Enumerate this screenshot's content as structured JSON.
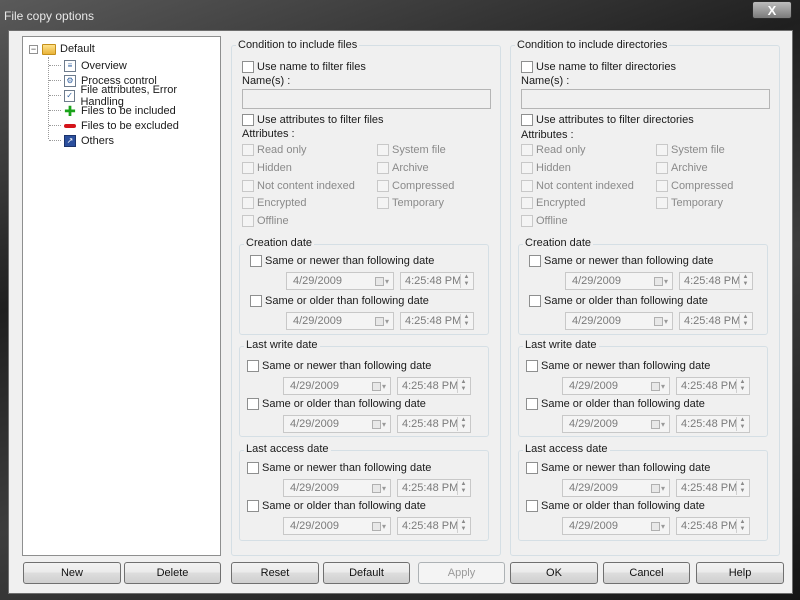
{
  "window": {
    "title": "File copy options",
    "close_glyph": "X"
  },
  "tree": {
    "root": {
      "label": "Default",
      "expander": "−",
      "icon": "folder-icon"
    },
    "items": [
      {
        "label": "Overview",
        "icon": "document-icon"
      },
      {
        "label": "Process control",
        "icon": "process-icon"
      },
      {
        "label": "File attributes, Error Handling",
        "icon": "check-icon"
      },
      {
        "label": "Files to be included",
        "icon": "plus-icon"
      },
      {
        "label": "Files to be excluded",
        "icon": "minus-icon"
      },
      {
        "label": "Others",
        "icon": "others-icon"
      }
    ]
  },
  "files_panel": {
    "title": "Condition to include files",
    "use_name": "Use name to filter files",
    "names_label": "Name(s) :",
    "names_value": "",
    "use_attributes": "Use attributes to filter files",
    "attributes_label": "Attributes :",
    "attrs_left": [
      "Read only",
      "Hidden",
      "Not content indexed",
      "Encrypted",
      "Offline"
    ],
    "attrs_right": [
      "System file",
      "Archive",
      "Compressed",
      "Temporary"
    ]
  },
  "dirs_panel": {
    "title": "Condition to include directories",
    "use_name": "Use name to filter directories",
    "names_label": "Name(s) :",
    "names_value": "",
    "use_attributes": "Use attributes to filter directories",
    "attributes_label": "Attributes :",
    "attrs_left": [
      "Read only",
      "Hidden",
      "Not content indexed",
      "Encrypted",
      "Offline"
    ],
    "attrs_right": [
      "System file",
      "Archive",
      "Compressed",
      "Temporary"
    ]
  },
  "date_groups": {
    "creation": "Creation date",
    "last_write": "Last write date",
    "last_access": "Last access date",
    "newer": "Same or newer than following date",
    "older": "Same or older than following date",
    "date_value": "4/29/2009",
    "time_value": "4:25:48 PM"
  },
  "buttons": {
    "new": "New",
    "delete": "Delete",
    "reset": "Reset",
    "default": "Default",
    "apply": "Apply",
    "ok": "OK",
    "cancel": "Cancel",
    "help": "Help"
  }
}
